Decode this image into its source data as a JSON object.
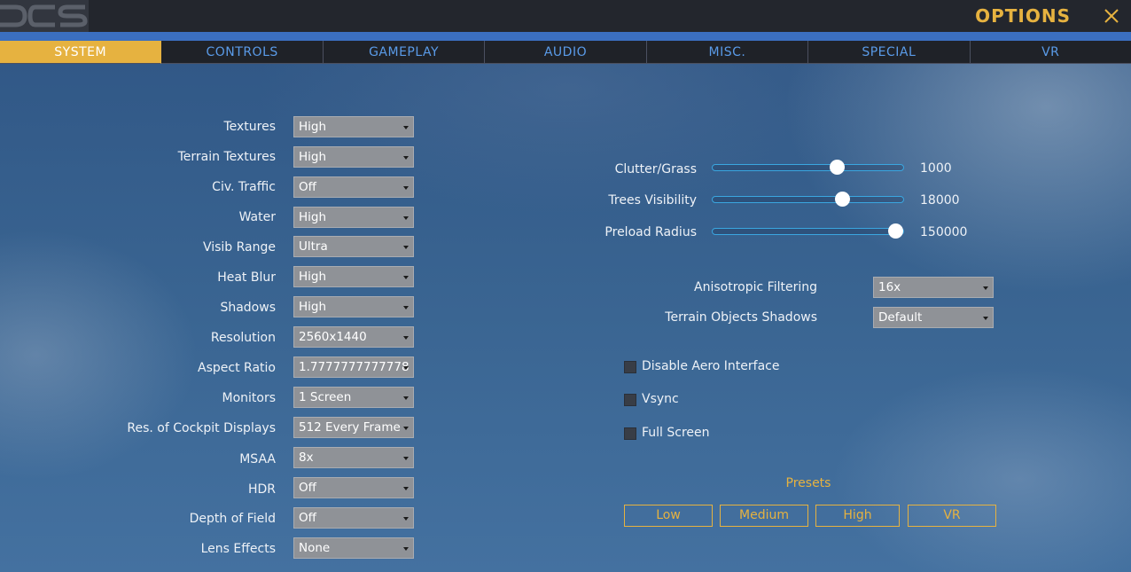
{
  "header": {
    "title": "OPTIONS",
    "close_icon": "close-icon",
    "logo_icon": "dcs-logo-icon"
  },
  "tabs": [
    {
      "label": "SYSTEM",
      "active": true
    },
    {
      "label": "CONTROLS",
      "active": false
    },
    {
      "label": "GAMEPLAY",
      "active": false
    },
    {
      "label": "AUDIO",
      "active": false
    },
    {
      "label": "MISC.",
      "active": false
    },
    {
      "label": "SPECIAL",
      "active": false
    },
    {
      "label": "VR",
      "active": false
    }
  ],
  "settings": [
    {
      "label": "Textures",
      "value": "High"
    },
    {
      "label": "Terrain Textures",
      "value": "High"
    },
    {
      "label": "Civ. Traffic",
      "value": "Off"
    },
    {
      "label": "Water",
      "value": "High"
    },
    {
      "label": "Visib Range",
      "value": "Ultra"
    },
    {
      "label": "Heat Blur",
      "value": "High"
    },
    {
      "label": "Shadows",
      "value": "High"
    },
    {
      "label": "Resolution",
      "value": "2560x1440"
    },
    {
      "label": "Aspect Ratio",
      "value": "1.7777777777778"
    },
    {
      "label": "Monitors",
      "value": "1 Screen"
    },
    {
      "label": "Res. of Cockpit Displays",
      "value": "512 Every Frame"
    },
    {
      "label": "MSAA",
      "value": "8x"
    },
    {
      "label": "HDR",
      "value": "Off"
    },
    {
      "label": "Depth of Field",
      "value": "Off"
    },
    {
      "label": "Lens Effects",
      "value": "None"
    }
  ],
  "sliders": [
    {
      "label": "Clutter/Grass",
      "value": "1000",
      "fraction": 0.65
    },
    {
      "label": "Trees Visibility",
      "value": "18000",
      "fraction": 0.68
    },
    {
      "label": "Preload Radius",
      "value": "150000",
      "fraction": 0.96
    }
  ],
  "right_selects": [
    {
      "label": "Anisotropic Filtering",
      "value": "16x"
    },
    {
      "label": "Terrain Objects Shadows",
      "value": "Default"
    }
  ],
  "checkboxes": [
    {
      "label": "Disable Aero Interface",
      "checked": false
    },
    {
      "label": "Vsync",
      "checked": false
    },
    {
      "label": "Full Screen",
      "checked": false
    }
  ],
  "presets": {
    "title": "Presets",
    "buttons": [
      "Low",
      "Medium",
      "High",
      "VR"
    ]
  },
  "colors": {
    "accent": "#e6b240",
    "tab_text": "#5a9be8",
    "slider_track": "#3aa6e0"
  }
}
